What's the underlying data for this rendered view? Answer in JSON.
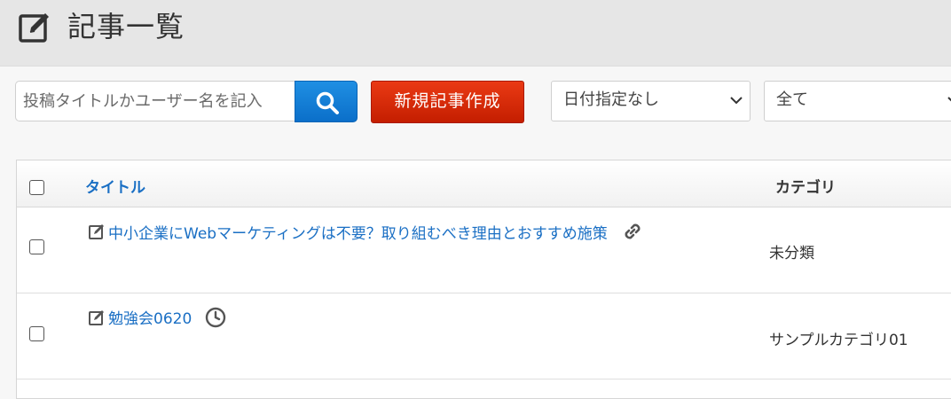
{
  "header": {
    "title": "記事一覧"
  },
  "toolbar": {
    "search_placeholder": "投稿タイトルかユーザー名を記入",
    "new_post_label": "新規記事作成",
    "date_filter": "日付指定なし",
    "status_filter": "全て"
  },
  "table": {
    "columns": {
      "title": "タイトル",
      "category": "カテゴリ"
    },
    "rows": [
      {
        "title": "中小企業にWebマーケティングは不要？取り組むべき理由とおすすめ施策",
        "status_icon": "link-icon",
        "category": "未分類"
      },
      {
        "title": "勉強会0620",
        "status_icon": "clock-icon",
        "category": "サンプルカテゴリ01"
      }
    ]
  }
}
